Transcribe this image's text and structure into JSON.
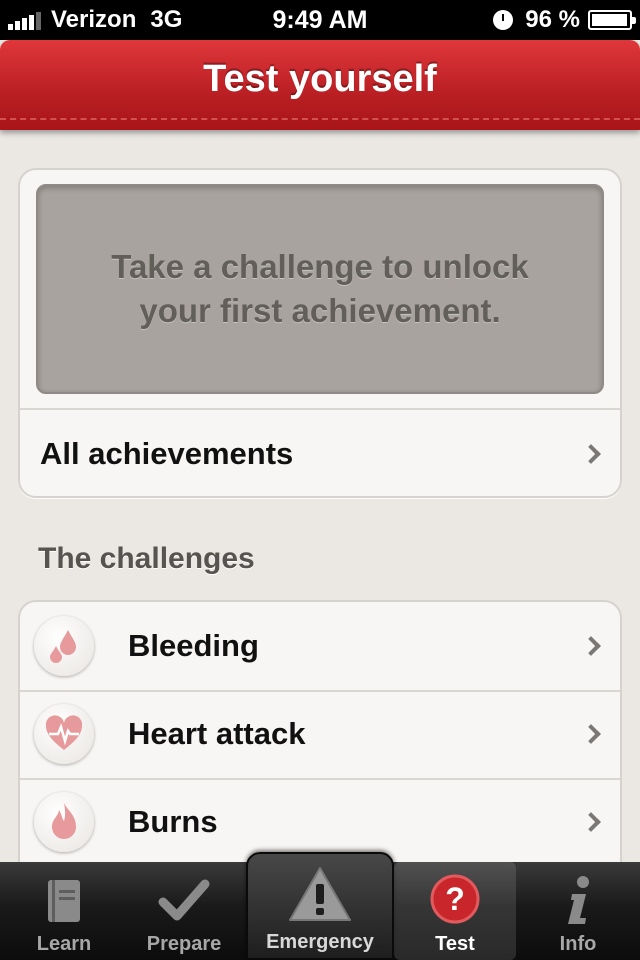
{
  "status_bar": {
    "carrier": "Verizon",
    "network": "3G",
    "time": "9:49 AM",
    "battery_percent": "96 %",
    "battery_level": 0.96
  },
  "nav": {
    "title": "Test yourself"
  },
  "achievements": {
    "message": "Take a challenge to unlock your first achievement.",
    "all_label": "All achievements"
  },
  "challenges": {
    "section_title": "The challenges",
    "items": [
      {
        "label": "Bleeding",
        "icon": "blood-drop-icon"
      },
      {
        "label": "Heart attack",
        "icon": "heart-pulse-icon"
      },
      {
        "label": "Burns",
        "icon": "flame-icon"
      }
    ]
  },
  "tabs": [
    {
      "label": "Learn",
      "icon": "book-icon"
    },
    {
      "label": "Prepare",
      "icon": "checkmark-icon"
    },
    {
      "label": "Emergency",
      "icon": "warning-icon"
    },
    {
      "label": "Test",
      "icon": "question-icon",
      "selected": true
    },
    {
      "label": "Info",
      "icon": "info-icon"
    }
  ],
  "colors": {
    "accent_red": "#c8262a",
    "background": "#ebe8e3",
    "tab_bar": "#1a1a1a"
  }
}
